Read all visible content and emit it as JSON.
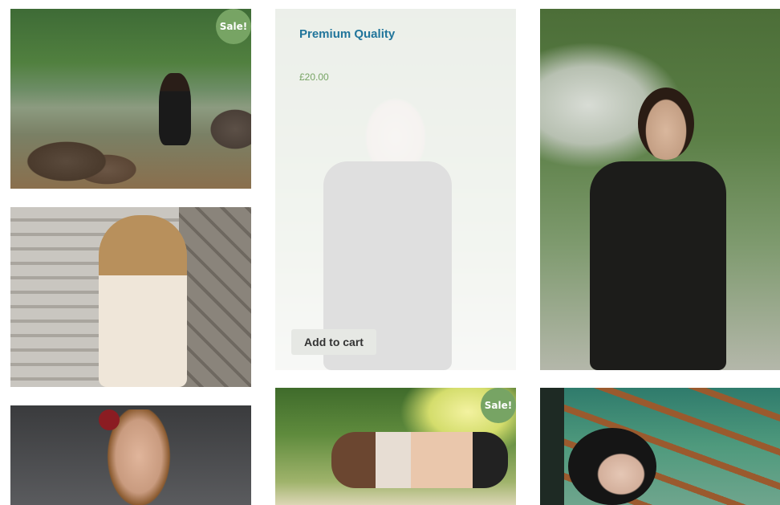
{
  "products": [
    {
      "id": "lake",
      "sale": true
    },
    {
      "id": "premium",
      "hover": true
    },
    {
      "id": "black-dress",
      "sale": false
    },
    {
      "id": "stairs",
      "sale": false
    },
    {
      "id": "portrait",
      "sale": false
    },
    {
      "id": "sitting",
      "sale": true
    },
    {
      "id": "pergola",
      "sale": false
    }
  ],
  "labels": {
    "sale_badge": "Sale!",
    "hover_title": "Premium Quality",
    "hover_price": "£20.00",
    "add_to_cart": "Add to cart"
  },
  "colors": {
    "sale_badge": "#77a464",
    "title": "#21759b",
    "price": "#77a464"
  }
}
